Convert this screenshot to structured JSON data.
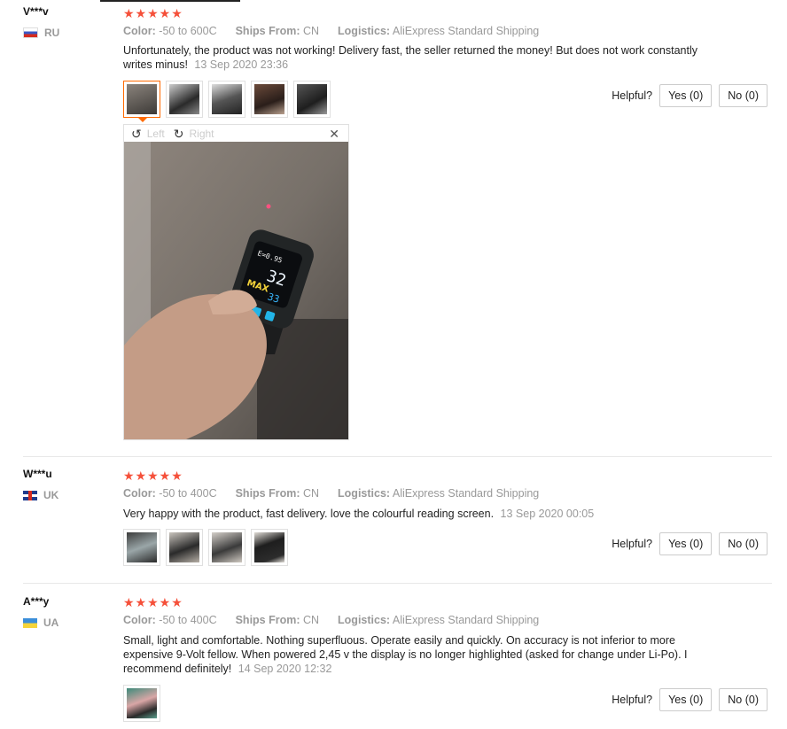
{
  "reviews": [
    {
      "user": "V***v",
      "country": "RU",
      "stars": "★★★★★",
      "color_label": "Color:",
      "color_value": "-50 to 600C",
      "ships_label": "Ships From:",
      "ships_value": "CN",
      "logistics_label": "Logistics:",
      "logistics_value": "AliExpress Standard Shipping",
      "text": "Unfortunately, the product was not working! Delivery fast, the seller returned the money! But does not work constantly writes minus!",
      "date": "13 Sep 2020 23:36",
      "helpful_label": "Helpful?",
      "yes_label": "Yes (0)",
      "no_label": "No (0)"
    },
    {
      "user": "W***u",
      "country": "UK",
      "stars": "★★★★★",
      "color_label": "Color:",
      "color_value": "-50 to 400C",
      "ships_label": "Ships From:",
      "ships_value": "CN",
      "logistics_label": "Logistics:",
      "logistics_value": "AliExpress Standard Shipping",
      "text": "Very happy with the product, fast delivery. love the colourful reading screen.",
      "date": "13 Sep 2020 00:05",
      "helpful_label": "Helpful?",
      "yes_label": "Yes (0)",
      "no_label": "No (0)"
    },
    {
      "user": "A***y",
      "country": "UA",
      "stars": "★★★★★",
      "color_label": "Color:",
      "color_value": "-50 to 400C",
      "ships_label": "Ships From:",
      "ships_value": "CN",
      "logistics_label": "Logistics:",
      "logistics_value": "AliExpress Standard Shipping",
      "text": "Small, light and comfortable. Nothing superfluous. Operate easily and quickly. On accuracy is not inferior to more expensive 9-Volt fellow. When powered 2,45 v the display is no longer highlighted (asked for change under Li-Po). I recommend definitely!",
      "date": "14 Sep 2020 12:32",
      "helpful_label": "Helpful?",
      "yes_label": "Yes (0)",
      "no_label": "No (0)"
    }
  ],
  "viewer": {
    "left_label": "Left",
    "right_label": "Right",
    "close_glyph": "✕",
    "rotate_left_glyph": "↺",
    "rotate_right_glyph": "↻",
    "screen": {
      "line1": "E=0.95",
      "line2": "32",
      "line3": "MAX",
      "line4": "33"
    }
  },
  "colors": {
    "star": "#f5503a",
    "active_thumb_border": "#ff6a00",
    "meta_gray": "#999999"
  },
  "icons": [
    "rotate-left-icon",
    "rotate-right-icon",
    "close-icon",
    "flag-ru-icon",
    "flag-uk-icon",
    "flag-ua-icon"
  ]
}
